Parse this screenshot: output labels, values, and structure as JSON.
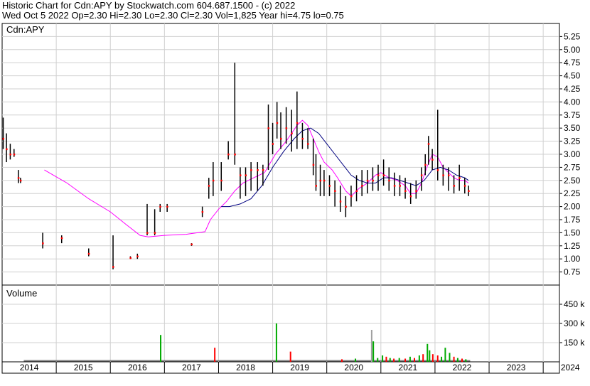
{
  "header": {
    "line1": "Historic Chart for Cdn:APY by Stockwatch.com 604.687.1500 - (c) 2022",
    "line2": "Wed Oct  5 2022  Op=2.30  Hi=2.30  Lo=2.30  Cl=2.30  Vol=1,825  Year hi=4.75  lo=0.75"
  },
  "chart_data": [
    {
      "type": "line",
      "panel": "price",
      "title": "Cdn:APY",
      "y_ticks": [
        "5.25",
        "5.00",
        "4.75",
        "4.50",
        "4.25",
        "4.00",
        "3.75",
        "3.50",
        "3.25",
        "3.00",
        "2.75",
        "2.50",
        "2.25",
        "2.00",
        "1.75",
        "1.50",
        "1.25",
        "1.00",
        "0.75"
      ],
      "ylim": [
        0.5,
        5.5
      ],
      "x_ticks": [
        "2014",
        "2015",
        "2016",
        "2017",
        "2018",
        "2019",
        "2020",
        "2021",
        "2022",
        "2023",
        "2024"
      ],
      "xlim": [
        2014.0,
        2024.3
      ],
      "grid": true,
      "series": [
        {
          "name": "",
          "role": "high-low-close bars",
          "color": "#000000",
          "close_color": "#ff0000",
          "points": [
            [
              2014.02,
              3.7,
              3.1,
              3.3
            ],
            [
              2014.08,
              3.4,
              2.85,
              3.1
            ],
            [
              2014.15,
              3.2,
              2.9,
              3.0
            ],
            [
              2014.22,
              3.1,
              2.95,
              3.0
            ],
            [
              2014.3,
              2.7,
              2.45,
              2.55
            ],
            [
              2014.34,
              2.55,
              2.45,
              2.5
            ],
            [
              2014.75,
              1.5,
              1.2,
              1.3
            ],
            [
              2015.1,
              1.45,
              1.3,
              1.4
            ],
            [
              2015.6,
              1.2,
              1.05,
              1.1
            ],
            [
              2016.05,
              1.45,
              0.8,
              0.85
            ],
            [
              2016.37,
              1.05,
              1.0,
              1.02
            ],
            [
              2016.5,
              1.1,
              1.0,
              1.05
            ],
            [
              2016.68,
              2.05,
              1.45,
              1.5
            ],
            [
              2016.82,
              1.95,
              1.45,
              1.5
            ],
            [
              2016.92,
              2.05,
              1.9,
              2.0
            ],
            [
              2017.05,
              2.05,
              1.9,
              2.0
            ],
            [
              2017.5,
              1.3,
              1.25,
              1.28
            ],
            [
              2017.7,
              2.0,
              1.8,
              1.9
            ],
            [
              2017.82,
              2.55,
              2.15,
              2.4
            ],
            [
              2017.9,
              2.85,
              2.2,
              2.5
            ],
            [
              2018.05,
              2.85,
              2.3,
              2.5
            ],
            [
              2018.18,
              3.25,
              2.9,
              3.0
            ],
            [
              2018.3,
              4.75,
              2.8,
              3.0
            ],
            [
              2018.4,
              2.75,
              2.15,
              2.6
            ],
            [
              2018.5,
              2.75,
              2.2,
              2.6
            ],
            [
              2018.6,
              2.85,
              2.3,
              2.7
            ],
            [
              2018.72,
              2.85,
              2.3,
              2.7
            ],
            [
              2018.82,
              2.8,
              2.4,
              2.7
            ],
            [
              2018.92,
              3.95,
              2.7,
              3.5
            ],
            [
              2019.0,
              3.6,
              3.0,
              3.2
            ],
            [
              2019.08,
              4.0,
              3.3,
              3.6
            ],
            [
              2019.15,
              3.8,
              3.1,
              3.3
            ],
            [
              2019.25,
              3.9,
              3.2,
              3.5
            ],
            [
              2019.35,
              3.85,
              3.05,
              3.4
            ],
            [
              2019.45,
              4.2,
              3.1,
              3.6
            ],
            [
              2019.55,
              3.6,
              3.1,
              3.3
            ],
            [
              2019.65,
              3.5,
              3.1,
              3.2
            ],
            [
              2019.75,
              3.3,
              2.6,
              2.8
            ],
            [
              2019.8,
              3.0,
              2.3,
              2.4
            ],
            [
              2019.88,
              2.8,
              2.2,
              2.5
            ],
            [
              2019.95,
              2.7,
              2.2,
              2.5
            ],
            [
              2020.05,
              2.6,
              2.2,
              2.4
            ],
            [
              2020.15,
              2.5,
              2.0,
              2.3
            ],
            [
              2020.25,
              2.4,
              1.9,
              2.1
            ],
            [
              2020.35,
              2.2,
              1.8,
              2.0
            ],
            [
              2020.45,
              2.4,
              2.0,
              2.2
            ],
            [
              2020.55,
              2.6,
              2.1,
              2.3
            ],
            [
              2020.65,
              2.7,
              2.2,
              2.4
            ],
            [
              2020.75,
              2.7,
              2.25,
              2.5
            ],
            [
              2020.85,
              2.75,
              2.3,
              2.5
            ],
            [
              2020.95,
              2.8,
              2.3,
              2.6
            ],
            [
              2021.05,
              2.9,
              2.4,
              2.6
            ],
            [
              2021.15,
              2.75,
              2.3,
              2.5
            ],
            [
              2021.25,
              2.65,
              2.2,
              2.4
            ],
            [
              2021.35,
              2.6,
              2.2,
              2.4
            ],
            [
              2021.45,
              2.55,
              2.15,
              2.3
            ],
            [
              2021.55,
              2.45,
              2.05,
              2.2
            ],
            [
              2021.65,
              2.5,
              2.15,
              2.3
            ],
            [
              2021.75,
              2.75,
              2.3,
              2.6
            ],
            [
              2021.82,
              3.0,
              2.6,
              2.8
            ],
            [
              2021.88,
              3.35,
              2.8,
              3.2
            ],
            [
              2021.95,
              3.1,
              2.7,
              2.9
            ],
            [
              2022.05,
              3.85,
              2.5,
              2.7
            ],
            [
              2022.15,
              2.8,
              2.4,
              2.6
            ],
            [
              2022.25,
              2.75,
              2.3,
              2.6
            ],
            [
              2022.35,
              2.6,
              2.25,
              2.4
            ],
            [
              2022.45,
              2.8,
              2.3,
              2.55
            ],
            [
              2022.55,
              2.55,
              2.25,
              2.4
            ],
            [
              2022.62,
              2.4,
              2.2,
              2.3
            ]
          ]
        },
        {
          "name": "",
          "role": "short moving average",
          "color": "#ff00ff",
          "points": [
            [
              2014.78,
              2.7
            ],
            [
              2015.2,
              2.45
            ],
            [
              2015.6,
              2.15
            ],
            [
              2016.0,
              1.9
            ],
            [
              2016.3,
              1.65
            ],
            [
              2016.55,
              1.45
            ],
            [
              2016.7,
              1.42
            ],
            [
              2017.0,
              1.45
            ],
            [
              2017.4,
              1.47
            ],
            [
              2017.75,
              1.52
            ],
            [
              2017.85,
              1.75
            ],
            [
              2018.0,
              1.95
            ],
            [
              2018.15,
              2.1
            ],
            [
              2018.3,
              2.3
            ],
            [
              2018.45,
              2.45
            ],
            [
              2018.65,
              2.55
            ],
            [
              2018.85,
              2.65
            ],
            [
              2019.05,
              3.0
            ],
            [
              2019.25,
              3.25
            ],
            [
              2019.45,
              3.55
            ],
            [
              2019.55,
              3.65
            ],
            [
              2019.65,
              3.55
            ],
            [
              2019.75,
              3.3
            ],
            [
              2019.85,
              3.05
            ],
            [
              2019.95,
              2.85
            ],
            [
              2020.1,
              2.7
            ],
            [
              2020.2,
              2.55
            ],
            [
              2020.35,
              2.3
            ],
            [
              2020.45,
              2.2
            ],
            [
              2020.6,
              2.35
            ],
            [
              2020.75,
              2.45
            ],
            [
              2020.9,
              2.6
            ],
            [
              2021.0,
              2.65
            ],
            [
              2021.15,
              2.55
            ],
            [
              2021.3,
              2.5
            ],
            [
              2021.45,
              2.4
            ],
            [
              2021.55,
              2.25
            ],
            [
              2021.65,
              2.25
            ],
            [
              2021.75,
              2.45
            ],
            [
              2021.85,
              2.75
            ],
            [
              2021.95,
              3.0
            ],
            [
              2022.05,
              2.95
            ],
            [
              2022.15,
              2.75
            ],
            [
              2022.25,
              2.65
            ],
            [
              2022.35,
              2.55
            ],
            [
              2022.45,
              2.5
            ],
            [
              2022.55,
              2.5
            ],
            [
              2022.62,
              2.45
            ]
          ]
        },
        {
          "name": "",
          "role": "long moving average",
          "color": "#000080",
          "points": [
            [
              2018.05,
              2.0
            ],
            [
              2018.2,
              2.0
            ],
            [
              2018.4,
              2.05
            ],
            [
              2018.6,
              2.15
            ],
            [
              2018.8,
              2.4
            ],
            [
              2019.0,
              2.75
            ],
            [
              2019.2,
              3.05
            ],
            [
              2019.4,
              3.3
            ],
            [
              2019.55,
              3.45
            ],
            [
              2019.7,
              3.5
            ],
            [
              2019.85,
              3.4
            ],
            [
              2020.0,
              3.2
            ],
            [
              2020.15,
              3.0
            ],
            [
              2020.3,
              2.8
            ],
            [
              2020.45,
              2.6
            ],
            [
              2020.6,
              2.5
            ],
            [
              2020.75,
              2.45
            ],
            [
              2020.9,
              2.45
            ],
            [
              2021.05,
              2.55
            ],
            [
              2021.2,
              2.55
            ],
            [
              2021.35,
              2.5
            ],
            [
              2021.5,
              2.45
            ],
            [
              2021.65,
              2.4
            ],
            [
              2021.8,
              2.5
            ],
            [
              2021.95,
              2.7
            ],
            [
              2022.1,
              2.75
            ],
            [
              2022.25,
              2.7
            ],
            [
              2022.4,
              2.6
            ],
            [
              2022.55,
              2.55
            ],
            [
              2022.62,
              2.5
            ]
          ]
        }
      ]
    },
    {
      "type": "bar",
      "panel": "volume",
      "title": "Volume",
      "y_ticks": [
        "450 k",
        "300 k",
        "150 k"
      ],
      "ylim": [
        0,
        600000
      ],
      "xlim": [
        2014.0,
        2024.3
      ],
      "grid": true,
      "up_color": "#00aa00",
      "down_color": "#ff0000",
      "baseline_color": "#808080",
      "bars": [
        [
          2016.93,
          210000,
          "up"
        ],
        [
          2017.93,
          110000,
          "down"
        ],
        [
          2019.07,
          300000,
          "up"
        ],
        [
          2019.33,
          80000,
          "down"
        ],
        [
          2020.28,
          20000,
          "down"
        ],
        [
          2020.53,
          25000,
          "up"
        ],
        [
          2020.83,
          250000,
          "neutral"
        ],
        [
          2020.86,
          160000,
          "up"
        ],
        [
          2020.94,
          30000,
          "up"
        ],
        [
          2021.03,
          50000,
          "up"
        ],
        [
          2021.1,
          40000,
          "down"
        ],
        [
          2021.17,
          30000,
          "up"
        ],
        [
          2021.24,
          25000,
          "down"
        ],
        [
          2021.34,
          30000,
          "up"
        ],
        [
          2021.45,
          25000,
          "down"
        ],
        [
          2021.54,
          40000,
          "up"
        ],
        [
          2021.62,
          30000,
          "down"
        ],
        [
          2021.71,
          50000,
          "up"
        ],
        [
          2021.78,
          60000,
          "down"
        ],
        [
          2021.86,
          140000,
          "up"
        ],
        [
          2021.9,
          90000,
          "up"
        ],
        [
          2021.96,
          60000,
          "down"
        ],
        [
          2022.05,
          50000,
          "down"
        ],
        [
          2022.12,
          40000,
          "up"
        ],
        [
          2022.19,
          110000,
          "up"
        ],
        [
          2022.27,
          70000,
          "up"
        ],
        [
          2022.35,
          40000,
          "down"
        ],
        [
          2022.42,
          30000,
          "up"
        ],
        [
          2022.5,
          25000,
          "down"
        ],
        [
          2022.57,
          20000,
          "up"
        ]
      ]
    }
  ]
}
